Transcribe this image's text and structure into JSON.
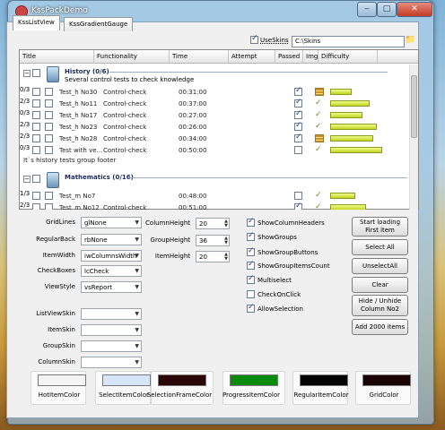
{
  "window": {
    "title": "KssPackDemo",
    "minimize": "‒",
    "maximize": "□",
    "close": "✕"
  },
  "tabs": [
    {
      "label": "KssListView"
    },
    {
      "label": "KssGradientGauge"
    }
  ],
  "skins": {
    "use_label": "UseSkins",
    "use_checked": true,
    "path": "C:\\Skins"
  },
  "list": {
    "columns": [
      "Title",
      "Functionality",
      "Time",
      "Attempt",
      "Passed",
      "Img",
      "Difficulty"
    ],
    "groups": [
      {
        "title": "History (0/6)",
        "subtitle": "Several control tests to check knowledge",
        "footer": "It`s history tests group footer",
        "rows": [
          {
            "name": "Test_h No30",
            "func": "Control-check",
            "time": "00:31:00",
            "attempt": "0/3",
            "passed": true,
            "img": "stack",
            "difficulty": 0.3
          },
          {
            "name": "Test_h No11",
            "func": "Control-check",
            "time": "00:37:00",
            "attempt": "2/3",
            "passed": true,
            "img": "check",
            "difficulty": 0.55
          },
          {
            "name": "Test_h No17",
            "func": "Control-check",
            "time": "00:27:00",
            "attempt": "0/3",
            "passed": true,
            "img": "check",
            "difficulty": 0.45
          },
          {
            "name": "Test_h No23",
            "func": "Control-check",
            "time": "00:26:00",
            "attempt": "2/3",
            "passed": true,
            "img": "check",
            "difficulty": 0.65
          },
          {
            "name": "Test_h No28",
            "func": "Control-check",
            "time": "00:34:00",
            "attempt": "2/3",
            "passed": true,
            "img": "stack",
            "difficulty": 0.6
          },
          {
            "name": "Test with ve...",
            "func": "Control-check",
            "time": "00:50:00",
            "attempt": "0/3",
            "passed": false,
            "img": "check",
            "difficulty": 0.72
          }
        ]
      },
      {
        "title": "Mathematics (0/16)",
        "subtitle": "",
        "rows": [
          {
            "name": "Test_m No7",
            "func": "",
            "time": "00:48:00",
            "attempt": "1/3",
            "passed": false,
            "img": "check",
            "difficulty": 0.35
          },
          {
            "name": "Test_m No12",
            "func": "Control-check",
            "time": "00:51:00",
            "attempt": "2/3",
            "passed": true,
            "img": "check",
            "difficulty": 0.5
          }
        ]
      }
    ]
  },
  "settings": {
    "gridlines": {
      "label": "GridLines",
      "value": "glNone"
    },
    "regularback": {
      "label": "RegularBack",
      "value": "rbNone"
    },
    "itemwidth": {
      "label": "ItemWidth",
      "value": "iwColumnsWidth"
    },
    "checkboxes": {
      "label": "CheckBoxes",
      "value": "lcCheck"
    },
    "viewstyle": {
      "label": "ViewStyle",
      "value": "vsReport"
    },
    "columnheight": {
      "label": "ColumnHeight",
      "value": "20"
    },
    "groupheight": {
      "label": "GroupHeight",
      "value": "36"
    },
    "itemheight": {
      "label": "ItemHeight",
      "value": "20"
    },
    "listviewskin": {
      "label": "ListViewSkin",
      "value": ""
    },
    "itemskin": {
      "label": "ItemSkin",
      "value": ""
    },
    "groupskin": {
      "label": "GroupSkin",
      "value": ""
    },
    "columnskin": {
      "label": "ColumnSkin",
      "value": ""
    }
  },
  "options": [
    {
      "label": "ShowColumnHeaders",
      "checked": true
    },
    {
      "label": "ShowGroups",
      "checked": true
    },
    {
      "label": "ShowGroupButtons",
      "checked": true
    },
    {
      "label": "ShowGroupItemsCount",
      "checked": true
    },
    {
      "label": "Multiselect",
      "checked": true
    },
    {
      "label": "CheckOnClick",
      "checked": false
    },
    {
      "label": "AllowSelection",
      "checked": true
    }
  ],
  "actions": [
    "Start loading First item",
    "Select All",
    "UnselectAll",
    "Clear",
    "Hide / Unhide Column No2",
    "Add 2000 items"
  ],
  "colors": [
    {
      "label": "HotItemColor",
      "color": "#f4f4f4"
    },
    {
      "label": "SelectItemColor",
      "color": "#d6e6f8"
    },
    {
      "label": "SelectionFrameColor",
      "color": "#2a0505"
    },
    {
      "label": "ProgressItemColor",
      "color": "#0a8a0a"
    },
    {
      "label": "RegularItemColor",
      "color": "#030303"
    },
    {
      "label": "GridColor",
      "color": "#1a0303"
    }
  ]
}
